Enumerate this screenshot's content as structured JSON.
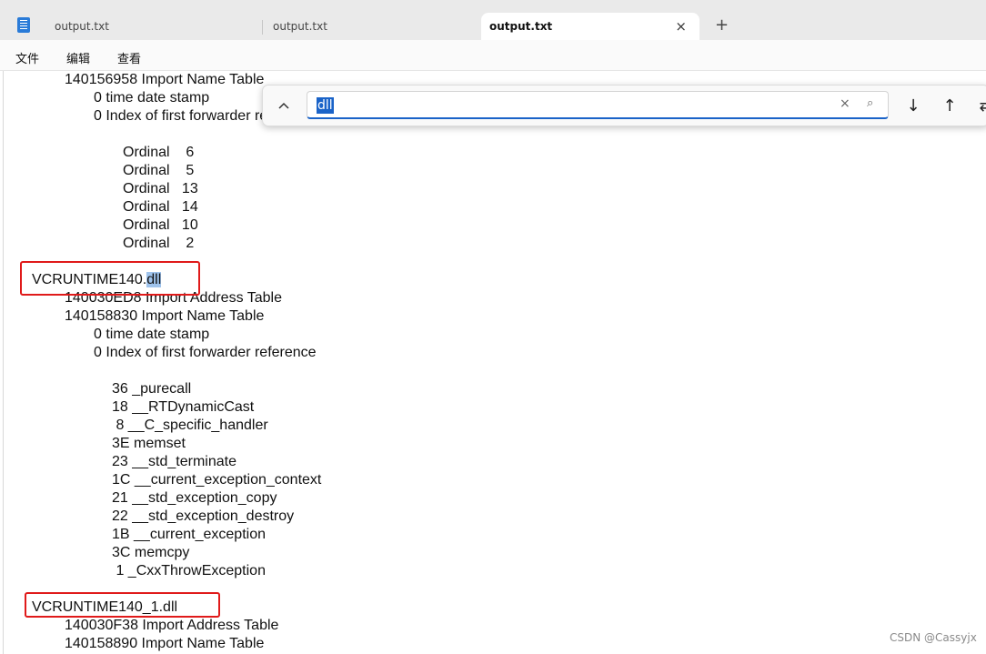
{
  "tabs": [
    {
      "label": "output.txt"
    },
    {
      "label": "output.txt"
    },
    {
      "label": "output.txt",
      "close_icon": "×"
    }
  ],
  "new_tab_icon": "+",
  "menu": {
    "file": "文件",
    "edit": "编辑",
    "view": "查看"
  },
  "find_bar": {
    "collapse_icon": "chevron-up-icon",
    "query": "dll",
    "clear_icon": "×",
    "search_icon": "⌕",
    "next_icon": "↓",
    "prev_icon": "↑",
    "more_icon": "⇄"
  },
  "lines": [
    "140156958 Import Name Table",
    "0 time date stamp",
    "0 Index of first forwarder reference",
    "Ordinal    6",
    "Ordinal    5",
    "Ordinal   13",
    "Ordinal   14",
    "Ordinal   10",
    "Ordinal    2",
    "VCRUNTIME140.",
    "dll",
    "140030ED8 Import Address Table",
    "140158830 Import Name Table",
    "0 time date stamp",
    "0 Index of first forwarder reference",
    "36 _purecall",
    "18 __RTDynamicCast",
    " 8 __C_specific_handler",
    "3E memset",
    "23 __std_terminate",
    "1C __current_exception_context",
    "21 __std_exception_copy",
    "22 __std_exception_destroy",
    "1B __current_exception",
    "3C memcpy",
    " 1 _CxxThrowException",
    "VCRUNTIME140_1.dll",
    "140030F38 Import Address Table",
    "140158890 Import Name Table"
  ],
  "watermark": "CSDN @Cassyjx",
  "colors": {
    "highlight_box": "#e01a1a",
    "accent": "#1a63c8",
    "match_highlight": "#9fc3ec"
  }
}
